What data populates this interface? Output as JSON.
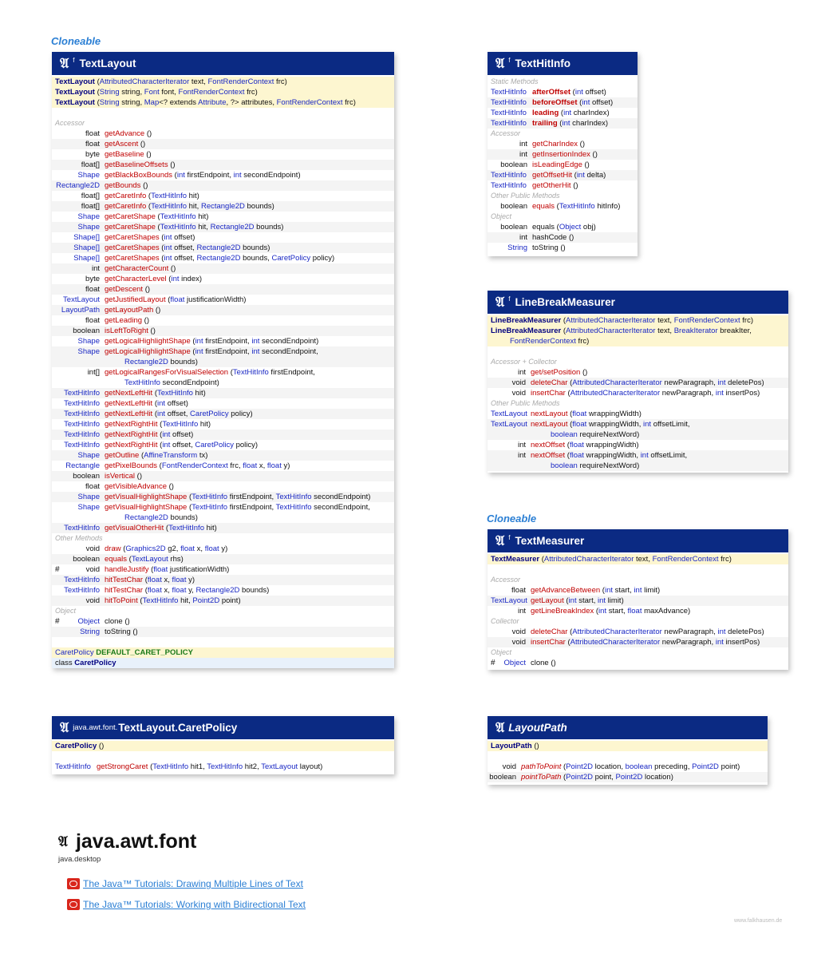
{
  "textlayout": {
    "iface": "Cloneable",
    "title": "TextLayout"
  },
  "texthitinfo": {
    "title": "TextHitInfo"
  },
  "linebreak": {
    "title": "LineBreakMeasurer"
  },
  "textmeasurer": {
    "iface": "Cloneable",
    "title": "TextMeasurer"
  },
  "caretpolicy": {
    "pkg": "java.awt.font.",
    "title": "TextLayout.CaretPolicy"
  },
  "layoutpath": {
    "title": "LayoutPath"
  },
  "package": {
    "name": "java.awt.font",
    "module": "java.desktop",
    "links": [
      "The Java™ Tutorials: Drawing Multiple Lines of Text",
      "The Java™ Tutorials: Working with Bidirectional Text"
    ]
  },
  "credit": "www.falkhausen.de",
  "glyph": "𝔄"
}
